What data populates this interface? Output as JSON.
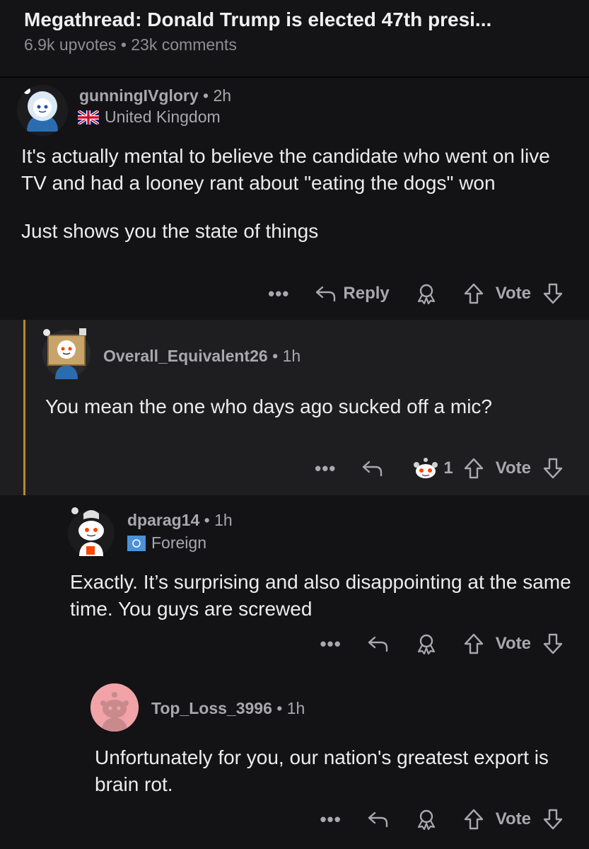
{
  "thread": {
    "title": "Megathread: Donald Trump is elected 47th presi...",
    "upvotes": "6.9k upvotes",
    "separator": "•",
    "comments": "23k comments"
  },
  "comments": [
    {
      "username": "gunningIVglory",
      "age": "2h",
      "flair": "United Kingdom",
      "paragraphs": [
        "It's actually mental to believe the candidate who went on live TV and had a looney rant about \"eating the dogs\" won",
        "Just shows you the state of things"
      ],
      "more": "•••",
      "reply_label": "Reply",
      "vote_label": "Vote"
    },
    {
      "username": "Overall_Equivalent26",
      "age": "1h",
      "paragraphs": [
        "You mean the one who days ago sucked off a mic?"
      ],
      "more": "•••",
      "award_count": "1",
      "vote_label": "Vote"
    },
    {
      "username": "dparag14",
      "age": "1h",
      "flair": "Foreign",
      "paragraphs": [
        "Exactly. It’s surprising and also disappointing at the same time. You guys are screwed"
      ],
      "more": "•••",
      "vote_label": "Vote"
    },
    {
      "username": "Top_Loss_3996",
      "age": "1h",
      "paragraphs": [
        "Unfortunately for you, our nation's greatest export is brain rot."
      ],
      "more": "•••",
      "vote_label": "Vote"
    }
  ],
  "icons": {
    "reply": "reply-arrow-icon",
    "award": "award-icon",
    "upvote": "upvote-arrow-icon",
    "downvote": "downvote-arrow-icon",
    "flag": "uk-flag-icon",
    "un_flag": "un-flag-icon"
  },
  "colors": {
    "background": "#131315",
    "highlight": "#1e1e20",
    "thread_line": "#b8892e",
    "text": "#ececec",
    "muted": "#a8a8ad"
  }
}
